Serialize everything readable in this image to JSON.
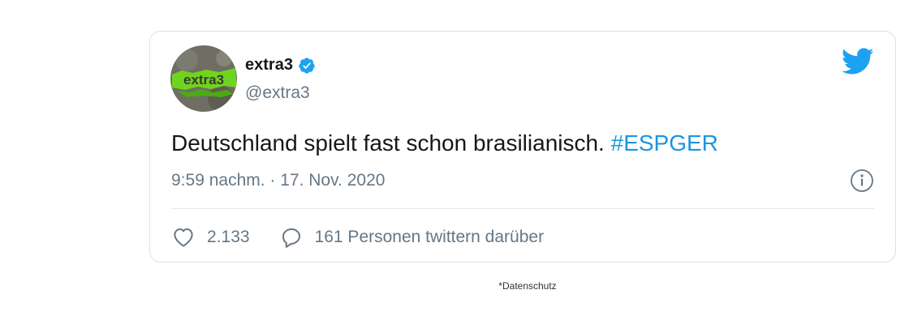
{
  "tweet": {
    "author_name": "extra3",
    "author_handle": "@extra3",
    "avatar_text": "extra3",
    "text": "Deutschland spielt fast schon brasilianisch. ",
    "hashtag": "#ESPGER",
    "timestamp": "9:59 nachm. · 17. Nov. 2020",
    "likes": "2.133",
    "replies_text": "161 Personen twittern darüber",
    "icons": [
      "verified-badge-icon",
      "twitter-bird-icon",
      "info-icon",
      "heart-icon",
      "reply-bubble-icon"
    ]
  },
  "footer": {
    "privacy_label": "*Datenschutz"
  },
  "colors": {
    "twitter_blue": "#1da1f2",
    "link_blue": "#1b95e0",
    "text_primary": "#14171a",
    "text_secondary": "#657786",
    "border": "#d9e1e7",
    "avatar_green": "#6fd41e"
  }
}
